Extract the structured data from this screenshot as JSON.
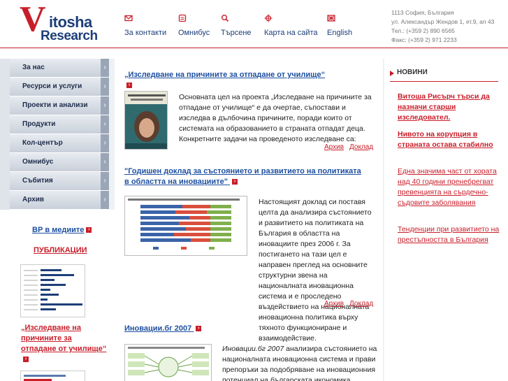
{
  "header": {
    "logo_line1": "itosha",
    "logo_letter": "V",
    "logo_line2": "Research",
    "nav": [
      {
        "label": "За контакти",
        "icon": "envelope-icon"
      },
      {
        "label": "Омнибус",
        "icon": "chart-icon"
      },
      {
        "label": "Търсене",
        "icon": "search-icon"
      },
      {
        "label": "Карта на сайта",
        "icon": "sitemap-icon"
      },
      {
        "label": "English",
        "icon": "flag-icon"
      }
    ],
    "contact": {
      "city": "1113 София, България",
      "street": "ул. Александър Жендов 1, ет.9, ап 43",
      "phone": "Тел.: (+359 2) 890 6565",
      "fax": "Факс: (+359 2) 971 2233"
    }
  },
  "sidebar": {
    "items": [
      {
        "label": "За нас"
      },
      {
        "label": "Ресурси и услуги"
      },
      {
        "label": "Проекти и анализи"
      },
      {
        "label": "Продукти"
      },
      {
        "label": "Кол-център"
      },
      {
        "label": "Омнибус"
      },
      {
        "label": "Събития"
      },
      {
        "label": "Архив"
      }
    ],
    "media_link": "ВР в медиите",
    "publications_title": "ПУБЛИКАЦИИ",
    "publication_caption": "„Изследване на причините за отпадане от училище“"
  },
  "articles": [
    {
      "title": "„Изследване на причините за отпадане от училище“",
      "body": "Основната цел на проекта „Изследване на причините за отпадане от училище“ е да очертае, съпостави и изследва в дълбочина причините, поради които от системата на образованието в страната отпадат деца. Конкретните задачи на проведеното изследване са:",
      "archive": "Архив",
      "report": "Доклад"
    },
    {
      "title": "\"Годишен доклад за състоянието и развитието на политиката в областта на иновациите\"",
      "body": "Настоящият доклад си поставя целта да анализира състоянието и развитието на политиката на България в областта на иновациите през 2006 г. За постигането на тази цел е направен преглед на основните структурни звена на националната иновационна система и е проследено въздействието на националната иновационна политика върху тяхното функциониране и взаимодействие.",
      "archive": "Архив",
      "report": "Доклад"
    },
    {
      "title": "Иновации.бг 2007",
      "body_em": "Иновации.бг  2007",
      "body": " анализира състоянието на националната иновационна система и прави препоръки за подобряване на иновационния потенциал на българската икономика. Поради"
    }
  ],
  "news": {
    "heading": "НОВИНИ",
    "items": [
      {
        "text": "Витоша Рисърч търси да назначи старши изследовател.",
        "bold": true
      },
      {
        "text": "Нивото на корупция в страната остава стабилно",
        "bold": true
      },
      {
        "text": "Една значима част от хората над 40 години пренебрегват превенцията на сърдечно-съдовите заболявания",
        "bold": false
      },
      {
        "text": "Тенденции при развитието на престъпността в България",
        "bold": false
      }
    ]
  },
  "colors": {
    "brand_red": "#c91e2a",
    "brand_blue": "#1d3e78",
    "link_blue": "#1d4fa0"
  }
}
